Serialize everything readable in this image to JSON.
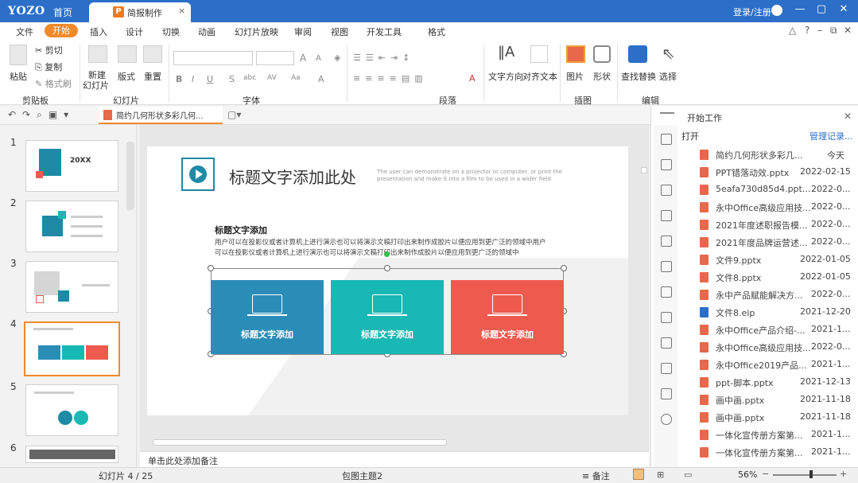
{
  "titlebar": {
    "logo": "YOZO",
    "home": "首页",
    "tab_label": "简报制作",
    "tab_icon": "P",
    "tab_close": "×",
    "login": "登录/注册",
    "bg": "#2b6fc9"
  },
  "menu": {
    "items": [
      "文件",
      "开始",
      "插入",
      "设计",
      "切换",
      "动画",
      "幻灯片放映",
      "审阅",
      "视图",
      "开发工具",
      "格式"
    ],
    "active": "开始",
    "accent": "#f08a2a"
  },
  "ribbon": {
    "clipboard": {
      "paste": "粘贴",
      "cut": "剪切",
      "copy": "复制",
      "format_brush": "格式刷",
      "group": "剪贴板"
    },
    "slides": {
      "new": "新建",
      "new2": "幻灯片",
      "layout": "版式",
      "reset": "重置",
      "group": "幻灯片"
    },
    "font": {
      "group": "字体",
      "bold": "B",
      "italic": "I",
      "underline": "U",
      "strike": "S",
      "grow": "A",
      "shrink": "A"
    },
    "paragraph": {
      "group": "段落"
    },
    "text_direction": "文字方向",
    "align_text": "对齐文本",
    "picture": "图片",
    "shape": "形状",
    "insert_group": "插图",
    "find_replace": "查找替换",
    "select": "选择",
    "edit_group": "编辑"
  },
  "doc_tab": {
    "label": "简约几何形状多彩几何..."
  },
  "thumbnails": {
    "numbers": [
      "1",
      "2",
      "3",
      "4",
      "5",
      "6"
    ],
    "selected": 4,
    "t1_title": "20XX"
  },
  "slide": {
    "title": "标题文字添加此处",
    "subtitle_en": "The user can demonstrate on a projector or computer, or print the presentation and make it into a film to be used in a wider field",
    "heading": "标题文字添加",
    "body1": "用户可以在投影仪或者计算机上进行演示也可以将演示文稿打印出来制作成胶片以便应用到更广泛的领域中用户",
    "body2": "可以在投影仪或者计算机上进行演示也可以将演示文稿打印出来制作成胶片以便应用到更广泛的领域中",
    "boxes": [
      {
        "label": "标题文字添加",
        "color": "#2a8db8"
      },
      {
        "label": "标题文字添加",
        "color": "#18b8b4"
      },
      {
        "label": "标题文字添加",
        "color": "#ef5a4f"
      }
    ]
  },
  "notes": {
    "placeholder": "单击此处添加备注"
  },
  "rightpane": {
    "title": "开始工作",
    "open": "打开",
    "manage": "管理记录...",
    "files": [
      {
        "name": "简约几何形状多彩几...",
        "date": "今天",
        "type": "ppt"
      },
      {
        "name": "PPT错落动效.pptx",
        "date": "2022-02-15",
        "type": "ppt"
      },
      {
        "name": "5eafa730d85d4.ppt...",
        "date": "2022-0...",
        "type": "ppt"
      },
      {
        "name": "永中Office高级应用技...",
        "date": "2022-0...",
        "type": "ppt"
      },
      {
        "name": "2021年度述职报告模...",
        "date": "2022-0...",
        "type": "ppt"
      },
      {
        "name": "2021年度品牌运营述...",
        "date": "2022-0...",
        "type": "ppt"
      },
      {
        "name": "文件9.pptx",
        "date": "2022-01-05",
        "type": "ppt"
      },
      {
        "name": "文件8.pptx",
        "date": "2022-01-05",
        "type": "ppt"
      },
      {
        "name": "永中产品赋能解决方...",
        "date": "2022-0...",
        "type": "ppt"
      },
      {
        "name": "文件8.eip",
        "date": "2021-12-20",
        "type": "eip"
      },
      {
        "name": "永中Office产品介绍-...",
        "date": "2021-1...",
        "type": "ppt"
      },
      {
        "name": "永中Office高级应用技...",
        "date": "2022-0...",
        "type": "ppt"
      },
      {
        "name": "永中Office2019产品...",
        "date": "2021-1...",
        "type": "ppt"
      },
      {
        "name": "ppt-脚本.pptx",
        "date": "2021-12-13",
        "type": "ppt"
      },
      {
        "name": "画中画.pptx",
        "date": "2021-11-18",
        "type": "ppt"
      },
      {
        "name": "画中画.pptx",
        "date": "2021-11-18",
        "type": "ppt"
      },
      {
        "name": "一体化宣传册方案第...",
        "date": "2021-1...",
        "type": "ppt"
      },
      {
        "name": "一体化宣传册方案第...",
        "date": "2021-1...",
        "type": "ppt"
      }
    ]
  },
  "status": {
    "slide": "幻灯片 4 / 25",
    "theme": "包图主题2",
    "notes": "备注",
    "zoom": "56%"
  }
}
